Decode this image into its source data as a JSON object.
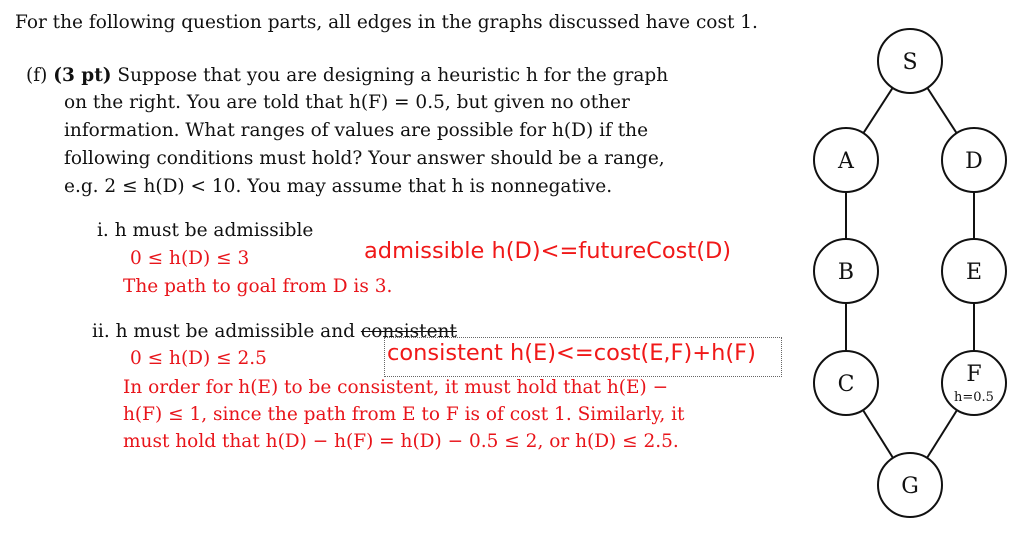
{
  "intro": "For the following question parts, all edges in the graphs discussed have cost 1.",
  "question": {
    "label": "(f)",
    "points": "(3 pt)",
    "lines": [
      "Suppose that you are designing a heuristic h for the graph",
      "on the right.  You are told that h(F) = 0.5, but given no other",
      "information.  What ranges of values are possible for h(D) if the",
      "following conditions must hold?  Your answer should be a range,",
      "e.g. 2 ≤ h(D) < 10. You may assume that h is nonnegative."
    ]
  },
  "part_i": {
    "label": "i.",
    "text": "h must be admissible",
    "answer": "0 ≤ h(D) ≤ 3",
    "explanation": "The path to goal from D is 3.",
    "annotation": "admissible h(D)<=futureCost(D)"
  },
  "part_ii": {
    "label": "ii.",
    "text_prefix": "h must be admissible and",
    "struck_word": "consistent",
    "answer": "0 ≤ h(D) ≤ 2.5",
    "explanation": [
      "In order for h(E) to be consistent, it must hold that h(E) −",
      "h(F) ≤ 1, since the path from E to F is of cost 1. Similarly, it",
      "must hold that h(D) − h(F) = h(D) − 0.5 ≤ 2, or h(D) ≤ 2.5."
    ],
    "annotation": "consistent h(E)<=cost(E,F)+h(F)"
  },
  "graph": {
    "nodes": [
      {
        "id": "S",
        "label": "S"
      },
      {
        "id": "A",
        "label": "A"
      },
      {
        "id": "D",
        "label": "D"
      },
      {
        "id": "B",
        "label": "B"
      },
      {
        "id": "E",
        "label": "E"
      },
      {
        "id": "C",
        "label": "C"
      },
      {
        "id": "F",
        "label": "F",
        "note": "h=0.5"
      },
      {
        "id": "G",
        "label": "G"
      }
    ],
    "edges": [
      [
        "S",
        "A"
      ],
      [
        "S",
        "D"
      ],
      [
        "A",
        "B"
      ],
      [
        "B",
        "C"
      ],
      [
        "C",
        "G"
      ],
      [
        "D",
        "E"
      ],
      [
        "E",
        "F"
      ],
      [
        "F",
        "G"
      ]
    ]
  }
}
